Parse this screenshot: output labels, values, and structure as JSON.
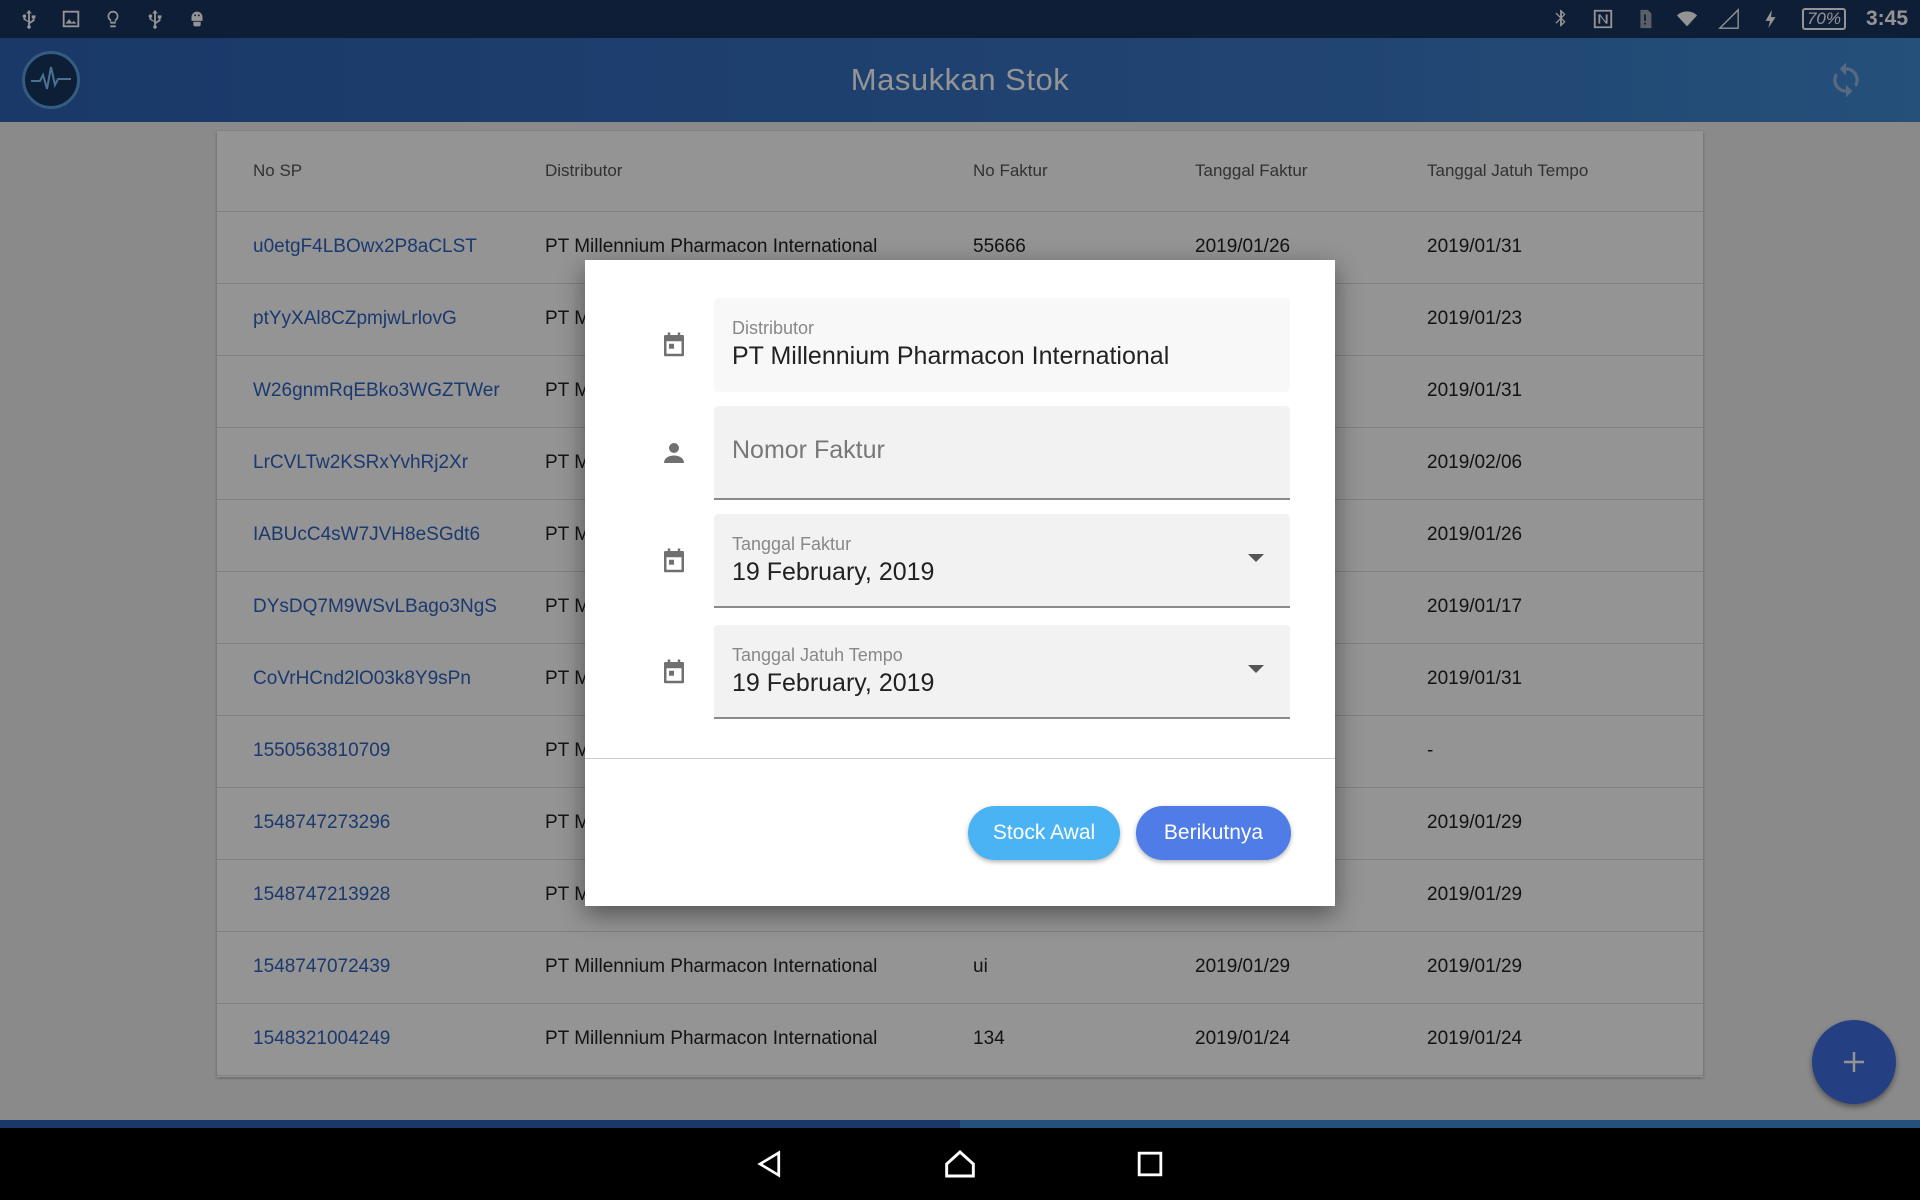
{
  "status_bar": {
    "battery": "70%",
    "time": "3:45"
  },
  "app_bar": {
    "title": "Masukkan Stok"
  },
  "table": {
    "columns": [
      "No SP",
      "Distributor",
      "No Faktur",
      "Tanggal Faktur",
      "Tanggal Jatuh Tempo"
    ],
    "rows": [
      [
        "u0etgF4LBOwx2P8aCLST",
        "PT Millennium Pharmacon International",
        "55666",
        "2019/01/26",
        "2019/01/31"
      ],
      [
        "ptYyXAl8CZpmjwLrlovG",
        "PT Millennium Pharmacon International",
        "",
        "",
        "2019/01/23"
      ],
      [
        "W26gnmRqEBko3WGZTWer",
        "PT Millennium Pharmacon International",
        "",
        "",
        "2019/01/31"
      ],
      [
        "LrCVLTw2KSRxYvhRj2Xr",
        "PT Millennium Pharmacon International",
        "",
        "",
        "2019/02/06"
      ],
      [
        "IABUcC4sW7JVH8eSGdt6",
        "PT Millennium Pharmacon International",
        "",
        "",
        "2019/01/26"
      ],
      [
        "DYsDQ7M9WSvLBago3NgS",
        "PT Millennium Pharmacon International",
        "",
        "",
        "2019/01/17"
      ],
      [
        "CoVrHCnd2lO03k8Y9sPn",
        "PT Millennium Pharmacon International",
        "",
        "",
        "2019/01/31"
      ],
      [
        "1550563810709",
        "PT Millennium Pharmacon International",
        "",
        "",
        "-"
      ],
      [
        "1548747273296",
        "PT Millennium Pharmacon International",
        "",
        "",
        "2019/01/29"
      ],
      [
        "1548747213928",
        "PT Millennium Pharmacon International",
        "",
        "",
        "2019/01/29"
      ],
      [
        "1548747072439",
        "PT Millennium Pharmacon International",
        "ui",
        "2019/01/29",
        "2019/01/29"
      ],
      [
        "1548321004249",
        "PT Millennium Pharmacon International",
        "134",
        "2019/01/24",
        "2019/01/24"
      ]
    ]
  },
  "dialog": {
    "distributor": {
      "label": "Distributor",
      "value": "PT Millennium Pharmacon International"
    },
    "nomor_faktur": {
      "placeholder": "Nomor Faktur"
    },
    "tanggal_faktur": {
      "label": "Tanggal Faktur",
      "value": "19 February, 2019"
    },
    "tanggal_jatuh_tempo": {
      "label": "Tanggal Jatuh Tempo",
      "value": "19 February, 2019"
    },
    "buttons": {
      "stock_awal": "Stock Awal",
      "berikutnya": "Berikutnya"
    }
  },
  "colors": {
    "primary": "#2d62b5",
    "accent": "#4f7ce6",
    "link": "#2f62c0",
    "stock_awal": "#4ab3f4"
  }
}
